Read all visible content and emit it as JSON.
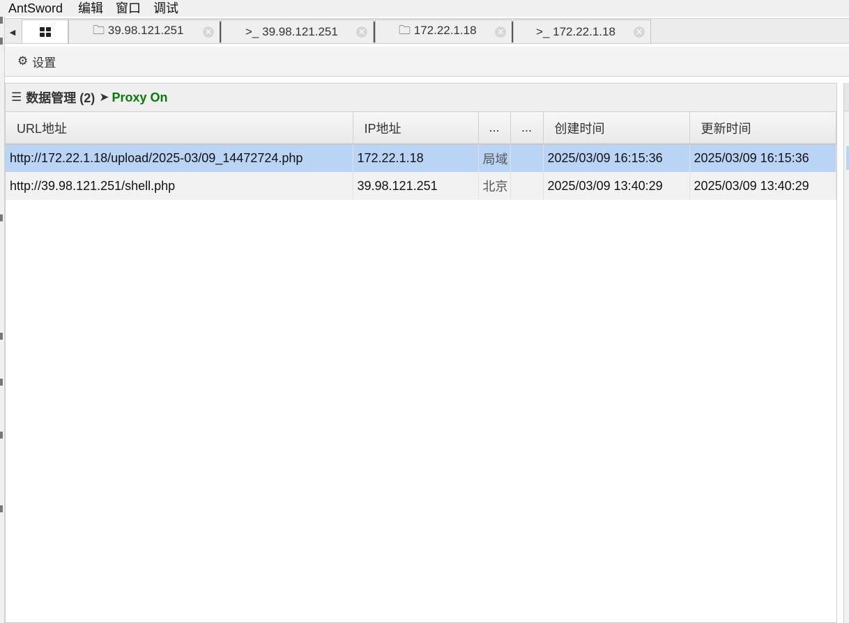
{
  "menubar": {
    "items": [
      "AntSword",
      "编辑",
      "窗口",
      "调试"
    ]
  },
  "tabs": [
    {
      "icon": "folder-icon",
      "glyph": "🗀",
      "label": "39.98.121.251"
    },
    {
      "icon": "terminal-icon",
      "glyph": ">_",
      "label": "39.98.121.251"
    },
    {
      "icon": "folder-icon",
      "glyph": "🗀",
      "label": "172.22.1.18"
    },
    {
      "icon": "terminal-icon",
      "glyph": ">_",
      "label": "172.22.1.18"
    }
  ],
  "toolbar": {
    "settings_label": "设置"
  },
  "panel": {
    "title": "数据管理 (2)",
    "proxy_label": "Proxy On",
    "proxy_color": "#0a7a0a"
  },
  "table": {
    "headers": [
      "URL地址",
      "IP地址",
      "...",
      "...",
      "创建时间",
      "更新时间"
    ],
    "rows": [
      {
        "url": "http://172.22.1.18/upload/2025-03/09_14472724.php",
        "ip": "172.22.1.18",
        "location": "局域",
        "note": "",
        "created": "2025/03/09 16:15:36",
        "updated": "2025/03/09 16:15:36",
        "selected": true
      },
      {
        "url": "http://39.98.121.251/shell.php",
        "ip": "39.98.121.251",
        "location": "北京",
        "note": "",
        "created": "2025/03/09 13:40:29",
        "updated": "2025/03/09 13:40:29",
        "selected": false
      }
    ]
  },
  "colors": {
    "selected_row": "#b9d4f5",
    "alt_row": "#f2f2f2"
  }
}
